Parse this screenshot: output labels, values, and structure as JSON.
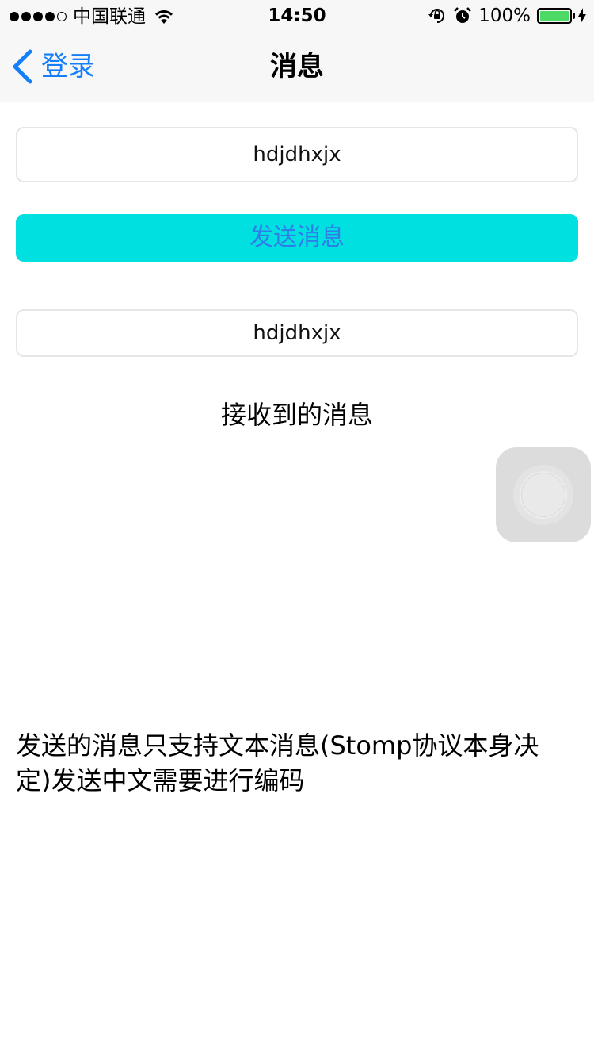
{
  "status_bar": {
    "carrier": "中国联通",
    "time": "14:50",
    "battery_percent": "100%",
    "battery_level": 1.0,
    "signal_bars": 4,
    "signal_max": 5,
    "battery_color": "#4cd964"
  },
  "nav": {
    "back_label": "登录",
    "title": "消息",
    "accent_color": "#157efb"
  },
  "form": {
    "message_input_value": "hdjdhxjx",
    "send_button_label": "发送消息",
    "send_button_bg": "#00e0e0",
    "received_value": "hdjdhxjx",
    "received_label": "接收到的消息"
  },
  "note": "发送的消息只支持文本消息(Stomp协议本身决定)发送中文需要进行编码",
  "icons": [
    "wifi-icon",
    "rotation-lock-icon",
    "alarm-icon",
    "battery-icon",
    "charging-icon",
    "back-chevron-icon",
    "assistive-touch-icon"
  ]
}
